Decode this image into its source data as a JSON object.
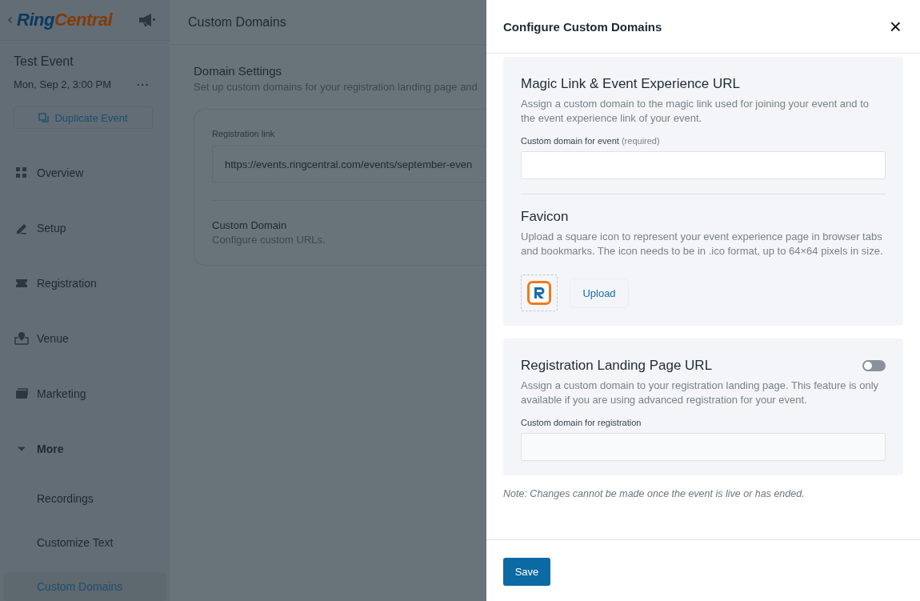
{
  "logo": {
    "parts": [
      {
        "text": "Ring",
        "color": "#0b3a60"
      },
      {
        "text": "Central",
        "color": "#843a06"
      }
    ]
  },
  "header": {
    "title": "Custom Domains"
  },
  "event": {
    "name": "Test Event",
    "date": "Mon, Sep 2, 3:00 PM",
    "more": "···",
    "duplicate_button": "Duplicate Event"
  },
  "sidebar": {
    "items": [
      {
        "label": "Overview",
        "kind": "grid",
        "selected": false
      },
      {
        "label": "Setup",
        "kind": "pencil",
        "selected": false
      },
      {
        "label": "Registration",
        "kind": "ticket",
        "selected": false
      },
      {
        "label": "Venue",
        "kind": "pin",
        "selected": false
      },
      {
        "label": "Marketing",
        "kind": "mail",
        "selected": false
      },
      {
        "label": "More",
        "kind": "group",
        "expanded": true,
        "selected": false,
        "children": [
          {
            "label": "Recordings",
            "selected": false
          },
          {
            "label": "Customize Text",
            "selected": false
          },
          {
            "label": "Custom Domains",
            "selected": true
          }
        ]
      }
    ]
  },
  "domain_settings": {
    "title": "Domain Settings",
    "description": "Set up custom domains for your registration landing page and",
    "registration_link": {
      "label": "Registration link",
      "value": "https://events.ringcentral.com/events/september-even"
    },
    "custom_domain": {
      "title": "Custom Domain",
      "description": "Configure custom URLs."
    }
  },
  "drawer": {
    "title": "Configure Custom Domains",
    "close": "×",
    "magic_link": {
      "title": "Magic Link & Event Experience URL",
      "description": "Assign a custom domain to the magic link used for joining your event and to the event experience link of your event.",
      "field_label": "Custom domain for event",
      "field_hint": "(required)"
    },
    "favicon": {
      "title": "Favicon",
      "description": "Upload a square icon to represent your event experience page in browser tabs and bookmarks. The icon needs to be in .ico format, up to 64×64 pixels in size.",
      "upload_button": "Upload"
    },
    "registration_landing": {
      "title": "Registration Landing Page URL",
      "on": false,
      "description": "Assign a custom domain to your registration landing page. This feature is only available if you are using advanced registration for your event.",
      "field_label": "Custom domain for registration"
    },
    "note": "Note: Changes cannot be made once the event is live or has ended.",
    "save_button": "Save"
  }
}
